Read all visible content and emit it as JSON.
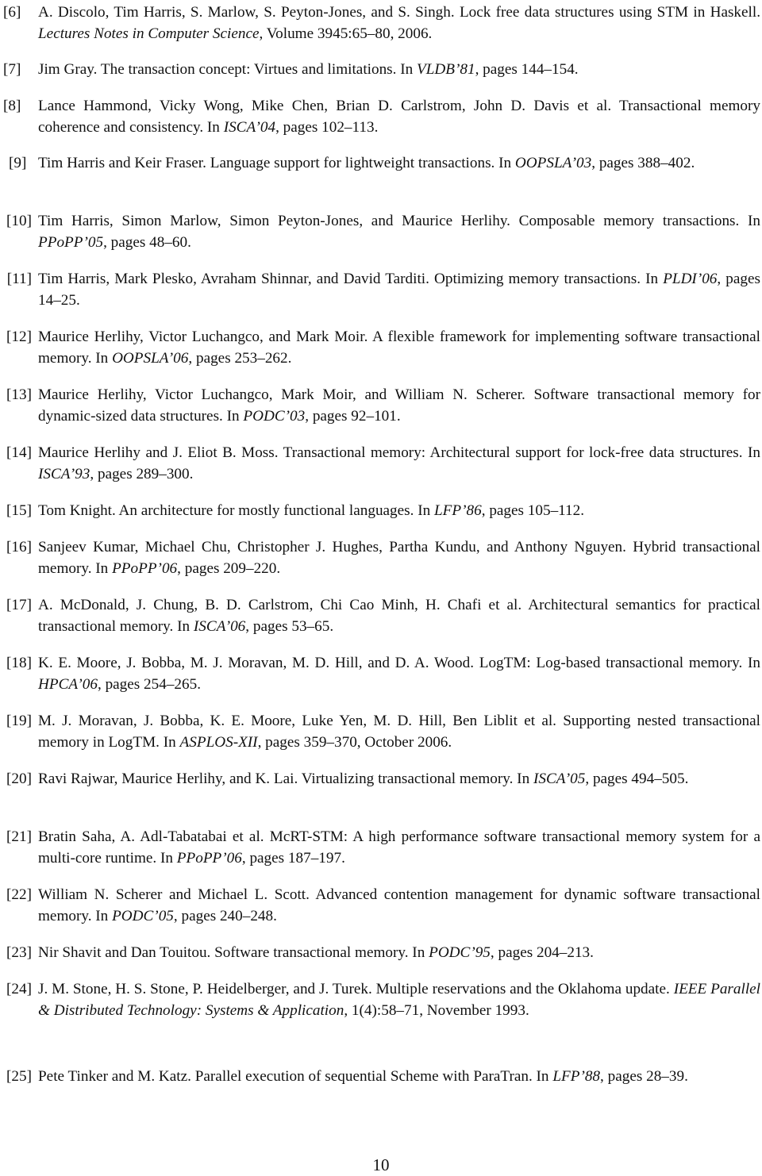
{
  "page": {
    "page_number": "10"
  },
  "references": [
    {
      "num": "[6]",
      "pre": "A. Discolo, Tim Harris, S. Marlow, S. Peyton-Jones, and S. Singh. Lock free data structures using STM in Haskell. ",
      "ital": "Lectures Notes in Computer Science",
      "post": ", Volume 3945:65–80, 2006."
    },
    {
      "num": "[7]",
      "pre": "Jim Gray. The transaction concept: Virtues and limitations. In ",
      "ital": "VLDB’81",
      "post": ", pages 144–154."
    },
    {
      "num": "[8]",
      "pre": "Lance Hammond, Vicky Wong, Mike Chen, Brian D. Carlstrom, John D. Davis et al. Transactional memory coherence and consistency. In ",
      "ital": "ISCA’04",
      "post": ", pages 102–113."
    },
    {
      "num": "[9]",
      "pre": "Tim Harris and Keir Fraser. Language support for lightweight transactions. In ",
      "ital": "OOPSLA’03",
      "post": ", pages 388–402."
    },
    {
      "num": "[10]",
      "pre": "Tim Harris, Simon Marlow, Simon Peyton-Jones, and Maurice Herlihy. Composable memory transactions. In ",
      "ital": "PPoPP’05",
      "post": ", pages 48–60."
    },
    {
      "num": "[11]",
      "pre": "Tim Harris, Mark Plesko, Avraham Shinnar, and David Tarditi. Optimizing memory transactions. In ",
      "ital": "PLDI’06",
      "post": ", pages 14–25."
    },
    {
      "num": "[12]",
      "pre": "Maurice Herlihy, Victor Luchangco, and Mark Moir. A flexible framework for implementing software transactional memory. In ",
      "ital": "OOPSLA’06",
      "post": ", pages 253–262."
    },
    {
      "num": "[13]",
      "pre": "Maurice Herlihy, Victor Luchangco, Mark Moir, and William N. Scherer. Software transactional memory for dynamic-sized data structures. In ",
      "ital": "PODC’03",
      "post": ", pages 92–101."
    },
    {
      "num": "[14]",
      "pre": "Maurice Herlihy and J. Eliot B. Moss. Transactional memory: Architectural support for lock-free data structures. In ",
      "ital": "ISCA’93",
      "post": ", pages 289–300."
    },
    {
      "num": "[15]",
      "pre": "Tom Knight. An architecture for mostly functional languages. In ",
      "ital": "LFP’86",
      "post": ", pages 105–112."
    },
    {
      "num": "[16]",
      "pre": "Sanjeev Kumar, Michael Chu, Christopher J. Hughes, Partha Kundu, and Anthony Nguyen. Hybrid transactional memory. In ",
      "ital": "PPoPP’06",
      "post": ", pages 209–220."
    },
    {
      "num": "[17]",
      "pre": "A. McDonald, J. Chung, B. D. Carlstrom, Chi Cao Minh, H. Chafi et al. Architectural semantics for practical transactional memory. In ",
      "ital": "ISCA’06",
      "post": ", pages 53–65."
    },
    {
      "num": "[18]",
      "pre": "K. E. Moore, J. Bobba, M. J. Moravan, M. D. Hill, and D. A. Wood. LogTM: Log-based transactional memory. In ",
      "ital": "HPCA’06",
      "post": ", pages 254–265."
    },
    {
      "num": "[19]",
      "pre": "M. J. Moravan, J. Bobba, K. E. Moore, Luke Yen, M. D. Hill, Ben Liblit et al. Supporting nested transactional memory in LogTM. In ",
      "ital": "ASPLOS-XII",
      "post": ", pages 359–370, October 2006."
    },
    {
      "num": "[20]",
      "pre": "Ravi Rajwar, Maurice Herlihy, and K. Lai. Virtualizing transactional memory. In ",
      "ital": "ISCA’05",
      "post": ", pages 494–505."
    },
    {
      "num": "[21]",
      "pre": "Bratin Saha, A. Adl-Tabatabai et al. McRT-STM: A high performance software transactional memory system for a multi-core runtime. In ",
      "ital": "PPoPP’06",
      "post": ", pages 187–197."
    },
    {
      "num": "[22]",
      "pre": "William N. Scherer and Michael L. Scott. Advanced contention management for dynamic software transactional memory. In ",
      "ital": "PODC’05",
      "post": ", pages 240–248."
    },
    {
      "num": "[23]",
      "pre": "Nir Shavit and Dan Touitou. Software transactional memory. In ",
      "ital": "PODC’95",
      "post": ", pages 204–213."
    },
    {
      "num": "[24]",
      "pre": "J. M. Stone, H. S. Stone, P. Heidelberger, and J. Turek. Multiple reservations and the Oklahoma update. ",
      "ital": "IEEE Parallel & Distributed Technology: Systems & Application",
      "post": ", 1(4):58–71, November 1993."
    },
    {
      "num": "[25]",
      "pre": "Pete Tinker and M. Katz. Parallel execution of sequential Scheme with ParaTran. In ",
      "ital": "LFP’88",
      "post": ", pages 28–39."
    }
  ]
}
